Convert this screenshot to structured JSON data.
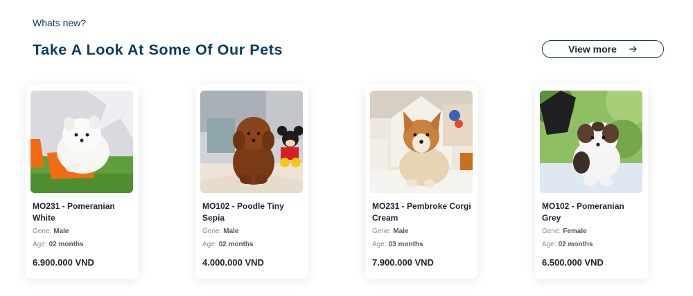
{
  "header": {
    "eyebrow": "Whats new?",
    "title": "Take A Look At Some Of Our Pets",
    "view_more_label": "View more",
    "view_more_icon": "arrow-right-icon",
    "accent_color": "#0b3b60"
  },
  "labels": {
    "gene": "Gene:",
    "age": "Age:"
  },
  "pets": [
    {
      "name": "MO231 - Pomeranian White",
      "gene": "Male",
      "age": "02 months",
      "price": "6.900.000 VND"
    },
    {
      "name": "MO102 - Poodle Tiny Sepia",
      "gene": "Male",
      "age": "02 months",
      "price": "4.000.000 VND"
    },
    {
      "name": "MO231 - Pembroke Corgi Cream",
      "gene": "Male",
      "age": "03 months",
      "price": "7.900.000 VND"
    },
    {
      "name": "MO102 -  Pomeranian Grey",
      "gene": "Female",
      "age": "02 months",
      "price": "6.500.000 VND"
    }
  ]
}
